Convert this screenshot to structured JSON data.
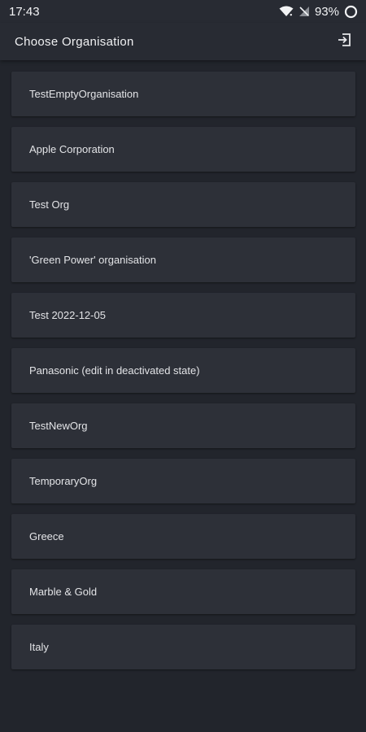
{
  "status_bar": {
    "time": "17:43",
    "battery": "93%",
    "icons": [
      "wifi-icon",
      "signal-off-icon",
      "battery-ring-icon"
    ]
  },
  "app_bar": {
    "title": "Choose Organisation",
    "action_icon": "logout-icon"
  },
  "organisations": [
    {
      "name": "TestEmptyOrganisation"
    },
    {
      "name": "Apple Corporation"
    },
    {
      "name": "Test Org"
    },
    {
      "name": "'Green Power' organisation"
    },
    {
      "name": "Test 2022-12-05"
    },
    {
      "name": "Panasonic (edit in deactivated state)"
    },
    {
      "name": "TestNewOrg"
    },
    {
      "name": "TemporaryOrg"
    },
    {
      "name": "Greece"
    },
    {
      "name": "Marble & Gold"
    },
    {
      "name": "Italy"
    }
  ],
  "colors": {
    "background": "#22252c",
    "bar": "#282b33",
    "card": "#2d3038",
    "text": "#e3e4e7"
  }
}
